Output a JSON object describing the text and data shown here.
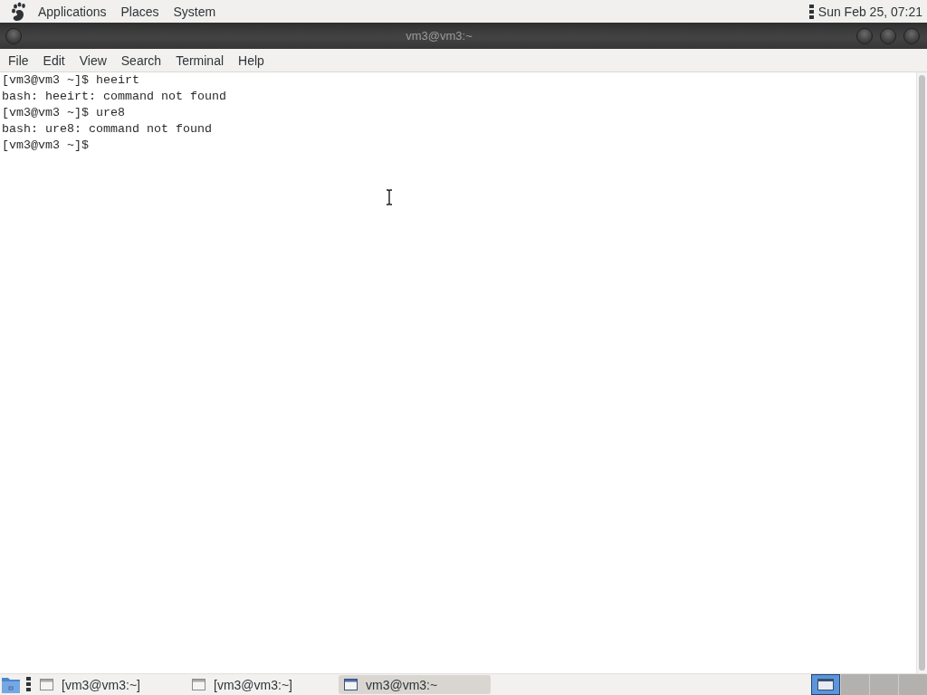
{
  "top_panel": {
    "menus": [
      "Applications",
      "Places",
      "System"
    ],
    "clock": "Sun Feb 25, 07:21"
  },
  "window": {
    "title": "vm3@vm3:~",
    "menu": [
      "File",
      "Edit",
      "View",
      "Search",
      "Terminal",
      "Help"
    ]
  },
  "terminal": {
    "lines": [
      "[vm3@vm3 ~]$ heeirt",
      "bash: heeirt: command not found",
      "[vm3@vm3 ~]$ ure8",
      "bash: ure8: command not found",
      "[vm3@vm3 ~]$"
    ]
  },
  "bottom_panel": {
    "tasks": [
      {
        "label": "[vm3@vm3:~]",
        "selected": false
      },
      {
        "label": "[vm3@vm3:~]",
        "selected": false
      },
      {
        "label": "vm3@vm3:~",
        "selected": true
      }
    ],
    "workspaces": [
      {
        "selected": true,
        "has_window": true
      },
      {
        "selected": false,
        "has_window": false
      },
      {
        "selected": false,
        "has_window": false
      },
      {
        "selected": false,
        "has_window": false
      }
    ]
  }
}
